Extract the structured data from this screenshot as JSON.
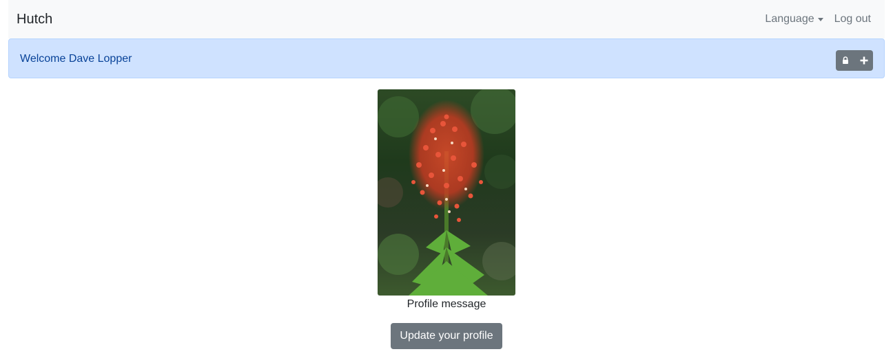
{
  "navbar": {
    "brand": "Hutch",
    "language_label": "Language",
    "logout_label": "Log out"
  },
  "alert": {
    "welcome_text": "Welcome Dave Lopper",
    "icons": [
      "lock-icon",
      "plus-icon"
    ]
  },
  "profile": {
    "photo_subject": "red-flowering-plant-photo",
    "message": "Profile message",
    "update_button_label": "Update your profile"
  },
  "colors": {
    "navbar_bg": "#f8f9fa",
    "alert_bg": "#cfe2ff",
    "alert_text": "#084298",
    "secondary": "#6c757d"
  }
}
